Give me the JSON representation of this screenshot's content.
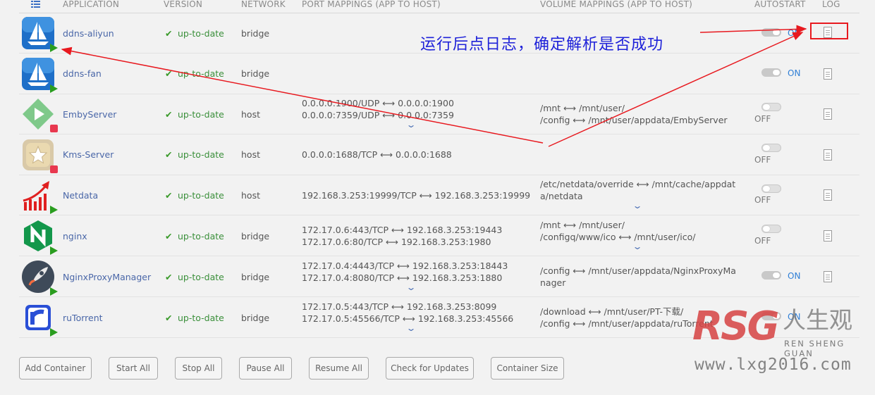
{
  "header": {
    "application": "APPLICATION",
    "version": "VERSION",
    "network": "NETWORK",
    "ports": "PORT MAPPINGS (APP TO HOST)",
    "volumes": "VOLUME MAPPINGS (APP TO HOST)",
    "autostart": "AUTOSTART",
    "log": "LOG"
  },
  "containers": [
    {
      "name": "ddns-aliyun",
      "icon": "sailboat-icon",
      "state": "running",
      "version": "up-to-date",
      "network": "bridge",
      "ports": [],
      "volumes": [],
      "autostart": true,
      "autostart_label": "ON"
    },
    {
      "name": "ddns-fan",
      "icon": "sailboat-icon",
      "state": "running",
      "version": "up-to-date",
      "network": "bridge",
      "ports": [],
      "volumes": [],
      "autostart": true,
      "autostart_label": "ON"
    },
    {
      "name": "EmbyServer",
      "icon": "emby-icon",
      "state": "stopped",
      "version": "up-to-date",
      "network": "host",
      "ports": [
        "0.0.0.0:1900/UDP ⟷ 0.0.0.0:1900",
        "0.0.0.0:7359/UDP ⟷ 0.0.0.0:7359"
      ],
      "volumes": [
        "/mnt ⟷ /mnt/user/",
        "/config ⟷ /mnt/user/appdata/EmbyServer"
      ],
      "autostart": false,
      "autostart_label": "OFF"
    },
    {
      "name": "Kms-Server",
      "icon": "star-icon",
      "state": "stopped",
      "version": "up-to-date",
      "network": "host",
      "ports": [
        "0.0.0.0:1688/TCP ⟷ 0.0.0.0:1688"
      ],
      "volumes": [],
      "autostart": false,
      "autostart_label": "OFF"
    },
    {
      "name": "Netdata",
      "icon": "netdata-icon",
      "state": "running",
      "version": "up-to-date",
      "network": "host",
      "ports": [
        "192.168.3.253:19999/TCP ⟷ 192.168.3.253:19999"
      ],
      "volumes": [
        "/etc/netdata/override ⟷ /mnt/cache/appdat",
        "a/netdata"
      ],
      "autostart": false,
      "autostart_label": "OFF"
    },
    {
      "name": "nginx",
      "icon": "nginx-icon",
      "state": "running",
      "version": "up-to-date",
      "network": "bridge",
      "ports": [
        "172.17.0.6:443/TCP ⟷ 192.168.3.253:19443",
        "172.17.0.6:80/TCP ⟷ 192.168.3.253:1980"
      ],
      "volumes": [
        "/mnt ⟷ /mnt/user/",
        "/configq/www/ico ⟷ /mnt/user/ico/"
      ],
      "autostart": false,
      "autostart_label": "OFF"
    },
    {
      "name": "NginxProxyManager",
      "icon": "rocket-icon",
      "state": "running",
      "version": "up-to-date",
      "network": "bridge",
      "ports": [
        "172.17.0.4:4443/TCP ⟷ 192.168.3.253:18443",
        "172.17.0.4:8080/TCP ⟷ 192.168.3.253:1880"
      ],
      "volumes": [
        "/config ⟷ /mnt/user/appdata/NginxProxyMa",
        "nager"
      ],
      "autostart": true,
      "autostart_label": "ON"
    },
    {
      "name": "ruTorrent",
      "icon": "rutorrent-icon",
      "state": "running",
      "version": "up-to-date",
      "network": "bridge",
      "ports": [
        "172.17.0.5:443/TCP ⟷ 192.168.3.253:8099",
        "172.17.0.5:45566/TCP ⟷ 192.168.3.253:45566"
      ],
      "volumes": [
        "/download ⟷ /mnt/user/PT-下载/",
        "/config ⟷ /mnt/user/appdata/ruTorrent"
      ],
      "autostart": true,
      "autostart_label": "ON"
    }
  ],
  "buttons": {
    "add": "Add Container",
    "start": "Start All",
    "stop": "Stop All",
    "pause": "Pause All",
    "resume": "Resume All",
    "check": "Check for Updates",
    "size": "Container Size"
  },
  "annotation": "运行后点日志，确定解析是否成功",
  "watermark": {
    "logo": "RSG",
    "cn": "人生观",
    "en": "REN SHENG GUAN",
    "url": "www.lxg2016.com"
  },
  "colors": {
    "running": "#2a9d1f",
    "stopped": "#e8384f",
    "annotation": "#1f22d9",
    "arrow": "#e8191f",
    "autostart_on": "#2f7fd6"
  }
}
